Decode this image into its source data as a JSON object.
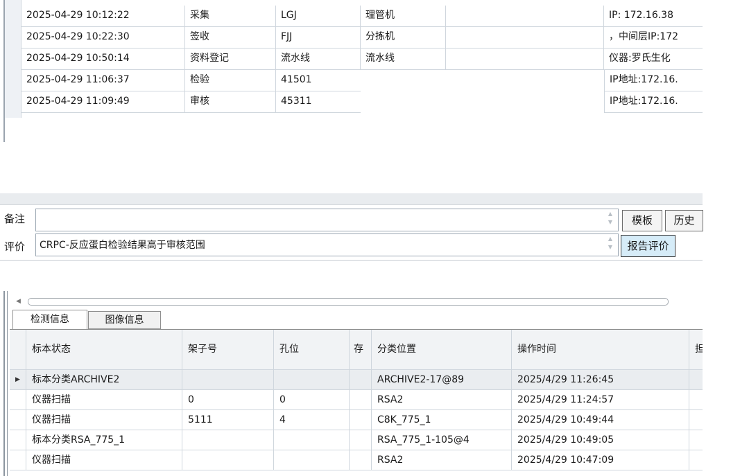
{
  "log": {
    "rows": [
      {
        "time": "2025-04-29 10:12:22",
        "action": "采集",
        "code": "LGJ",
        "device": "理管机",
        "extra": "",
        "detail": "IP: 172.16.38"
      },
      {
        "time": "2025-04-29 10:22:30",
        "action": "签收",
        "code": "FJJ",
        "device": "分拣机",
        "extra": "",
        "detail": "，中间层IP:172"
      },
      {
        "time": "2025-04-29 10:50:14",
        "action": "资料登记",
        "code": "流水线",
        "device": "流水线",
        "extra": "",
        "detail": "仪器:罗氏生化"
      },
      {
        "time": "2025-04-29 11:06:37",
        "action": "检验",
        "code": "41501",
        "device": "",
        "extra": "",
        "detail": "IP地址:172.16."
      },
      {
        "time": "2025-04-29 11:09:49",
        "action": "审核",
        "code": "45311",
        "device": "",
        "extra": "",
        "detail": "IP地址:172.16."
      }
    ]
  },
  "remark": {
    "note_label": "备注",
    "note_value": "",
    "eval_label": "评价",
    "eval_value": "CRPC-反应蛋白检验结果高于审核范围",
    "template_button": "模板",
    "history_button": "历史",
    "report_eval_button": "报告评价"
  },
  "detect": {
    "tabs": [
      "检测信息",
      "图像信息"
    ],
    "active_tab": 0,
    "columns": [
      "标本状态",
      "架子号",
      "孔位",
      "存",
      "分类位置",
      "操作时间",
      "担"
    ],
    "rows": [
      [
        "标本分类ARCHIVE2",
        "",
        "",
        "",
        "ARCHIVE2-17@89",
        "2025/4/29 11:26:45",
        ""
      ],
      [
        "仪器扫描",
        "0",
        "0",
        "",
        "RSA2",
        "2025/4/29 11:24:57",
        ""
      ],
      [
        "仪器扫描",
        "5111",
        "4",
        "",
        "C8K_775_1",
        "2025/4/29 10:49:44",
        ""
      ],
      [
        "标本分类RSA_775_1",
        "",
        "",
        "",
        "RSA_775_1-105@4",
        "2025/4/29 10:49:05",
        ""
      ],
      [
        "仪器扫描",
        "",
        "",
        "",
        "RSA2",
        "2025/4/29 10:47:09",
        ""
      ]
    ],
    "selected_row": 0,
    "row_indicator": "▶"
  }
}
